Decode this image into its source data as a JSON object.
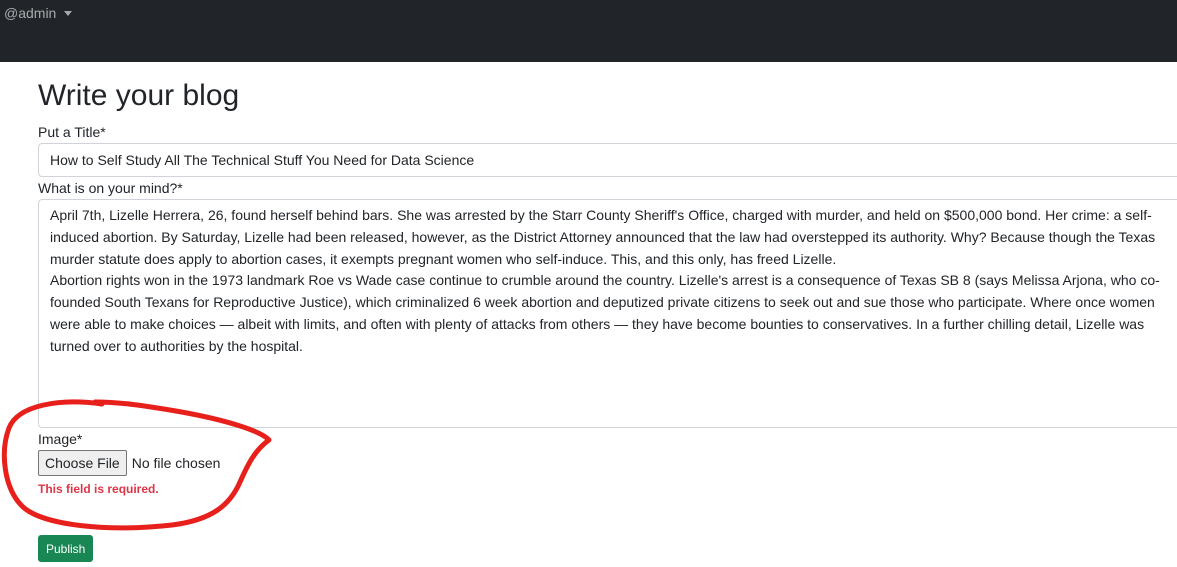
{
  "navbar": {
    "user_label": "@admin"
  },
  "page": {
    "title": "Write your blog"
  },
  "form": {
    "title_label": "Put a Title*",
    "title_value": "How to Self Study All The Technical Stuff You Need for Data Science",
    "body_label": "What is on your mind?*",
    "body_value": "April 7th, Lizelle Herrera, 26, found herself behind bars. She was arrested by the Starr County Sheriff's Office, charged with murder, and held on $500,000 bond. Her crime: a self-induced abortion. By Saturday, Lizelle had been released, however, as the District Attorney announced that the law had overstepped its authority. Why? Because though the Texas murder statute does apply to abortion cases, it exempts pregnant women who self-induce. This, and this only, has freed Lizelle.\nAbortion rights won in the 1973 landmark Roe vs Wade case continue to crumble around the country. Lizelle's arrest is a consequence of Texas SB 8 (says Melissa Arjona, who co-founded South Texans for Reproductive Justice), which criminalized 6 week abortion and deputized private citizens to seek out and sue those who participate. Where once women were able to make choices — albeit with limits, and often with plenty of attacks from others — they have become bounties to conservatives. In a further chilling detail, Lizelle was turned over to authorities by the hospital.",
    "image_label": "Image*",
    "file_button_label": "Choose File",
    "file_status": "No file chosen",
    "error_message": "This field is required.",
    "publish_label": "Publish"
  },
  "colors": {
    "navbar_bg": "#212529",
    "error": "#dc3545",
    "publish": "#198754",
    "annotation": "#e8201c"
  }
}
